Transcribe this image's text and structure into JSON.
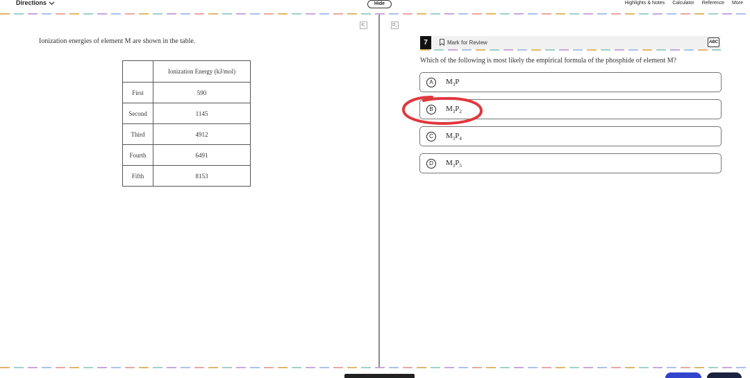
{
  "topbar": {
    "directions_label": "Directions",
    "hide_label": "Hide",
    "tools": [
      "Highlights & Notes",
      "Calculator",
      "Reference",
      "More"
    ]
  },
  "passage": {
    "intro_text": "Ionization energies of element M are shown in the table.",
    "table": {
      "header": [
        "",
        "Ionization Energy (kJ/mol)"
      ],
      "rows": [
        [
          "First",
          "590"
        ],
        [
          "Second",
          "1145"
        ],
        [
          "Third",
          "4912"
        ],
        [
          "Fourth",
          "6491"
        ],
        [
          "Fifth",
          "8153"
        ]
      ]
    }
  },
  "question_panel": {
    "number": "7",
    "mark_for_review_label": "Mark for Review",
    "abc_label": "ABC",
    "question_text": "Which of the following is most likely the empirical formula of the phosphide of element M?",
    "choices": [
      {
        "letter": "A",
        "formula_base": "M",
        "sub1": "3",
        "p": "P",
        "sub2": ""
      },
      {
        "letter": "B",
        "formula_base": "M",
        "sub1": "3",
        "p": "P",
        "sub2": "2"
      },
      {
        "letter": "C",
        "formula_base": "M",
        "sub1": "3",
        "p": "P",
        "sub2": "4"
      },
      {
        "letter": "D",
        "formula_base": "M",
        "sub1": "3",
        "p": "P",
        "sub2": "5"
      }
    ],
    "highlighted_choice": "B",
    "highlight_color": "#e0383e"
  },
  "colors": {
    "divider": "#8a8a8a",
    "back_button": "#3344cc",
    "next_button": "#1c2340"
  }
}
